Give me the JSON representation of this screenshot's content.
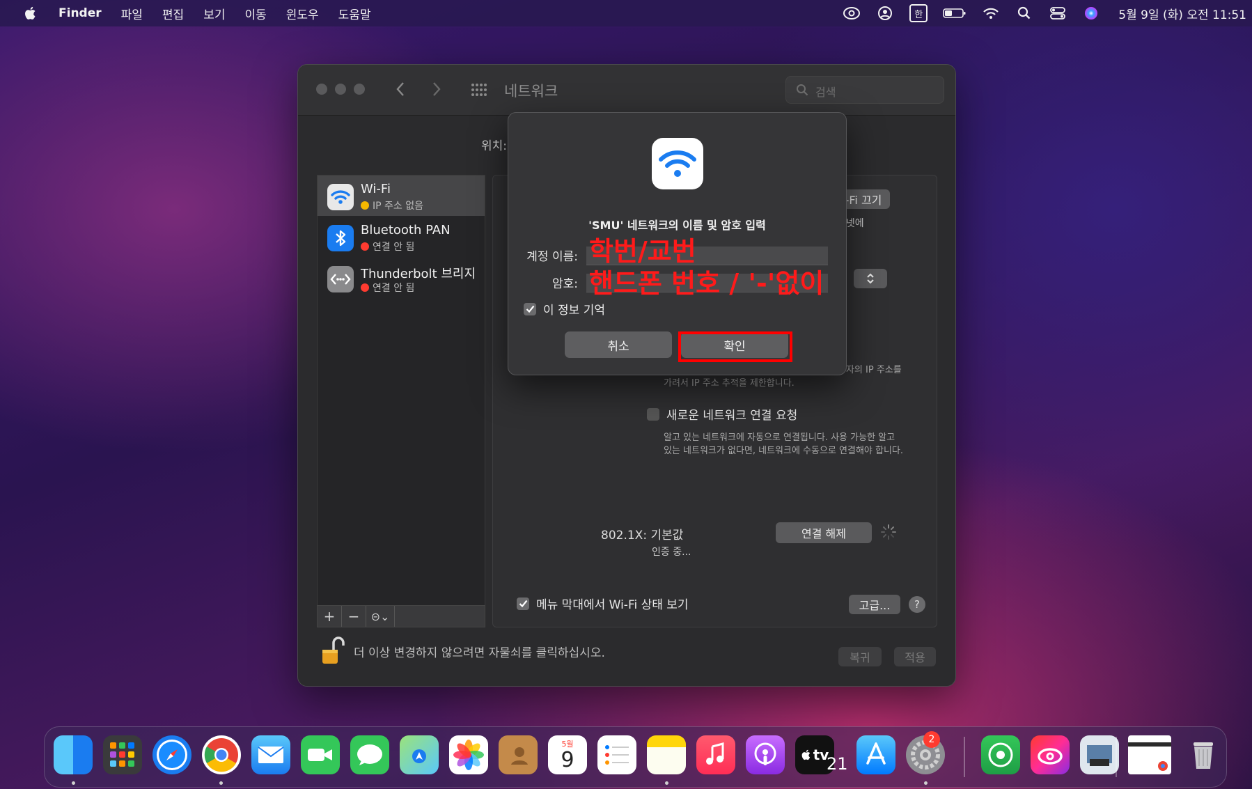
{
  "menubar": {
    "app_name": "Finder",
    "menus": [
      "파일",
      "편집",
      "보기",
      "이동",
      "윈도우",
      "도움말"
    ],
    "input_source": "한",
    "clock": "5월 9일 (화) 오전 11:51"
  },
  "window": {
    "title": "네트워크",
    "search_placeholder": "검색",
    "location_label": "위치:"
  },
  "services": [
    {
      "name": "Wi-Fi",
      "status": "IP 주소 없음",
      "status_color": "#f5b800"
    },
    {
      "name": "Bluetooth PAN",
      "status": "연결 안 됨",
      "status_color": "#ff3b30"
    },
    {
      "name": "Thunderbolt 브리지",
      "status": "연결 안 됨",
      "status_color": "#ff3b30"
    }
  ],
  "sidebar_tools": {
    "add": "+",
    "remove": "−",
    "more": "⊝⌄"
  },
  "wifi_panel": {
    "wifi_off_button": "-Fi 끄기",
    "wifi_side_text": "터넷에",
    "limit_ip_desc_line1": "공자의 IP 주소를",
    "limit_ip_desc_line2": "가려서 IP 주소 추적을 제한합니다.",
    "ask_join_label": "새로운 네트워크 연결 요청",
    "ask_join_desc": "알고 있는 네트워크에 자동으로 연결됩니다. 사용 가능한 알고 있는 네트워크가 없다면, 네트워크에 수동으로 연결해야 합니다.",
    "x8021_label": "802.1X: 기본값",
    "auth_status": "인증 중...",
    "disconnect_button": "연결 해제",
    "show_status_label": "메뉴 막대에서 Wi-Fi 상태 보기",
    "advanced_button": "고급...",
    "help_button": "?"
  },
  "footer": {
    "lock_text": "더 이상 변경하지 않으려면 자물쇠를 클릭하십시오.",
    "revert_button": "복귀",
    "apply_button": "적용"
  },
  "dialog": {
    "title": "'SMU' 네트워크의 이름 및 암호 입력",
    "account_label": "계정 이름:",
    "password_label": "암호:",
    "account_overlay": "학번/교번",
    "password_overlay": "핸드폰 번호 / '-'없이",
    "remember_label": "이 정보 기억",
    "cancel_button": "취소",
    "ok_button": "확인",
    "highlight_color": "#ff0000"
  },
  "dock": {
    "calendar_month": "5월",
    "calendar_day": "9",
    "settings_badge": "2",
    "tv_label": "tv",
    "page_number": "21"
  }
}
